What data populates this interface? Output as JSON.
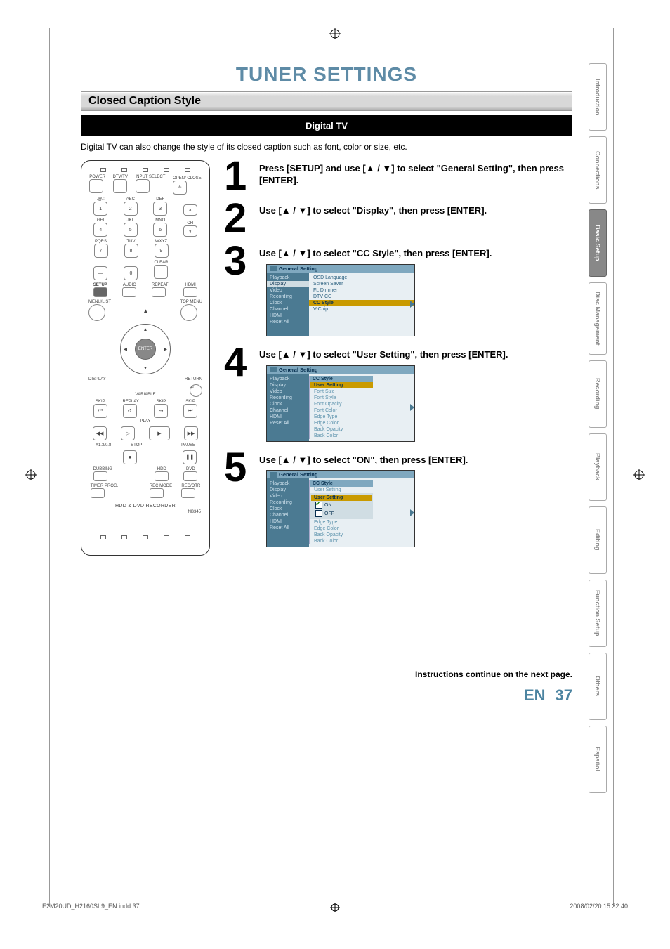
{
  "title": "TUNER SETTINGS",
  "section": "Closed Caption Style",
  "digital_tv": "Digital TV",
  "intro": "Digital TV can also change the style of its closed caption such as font, color or size, etc.",
  "remote": {
    "row1": [
      "POWER",
      "DTV/TV",
      "INPUT SELECT",
      "OPEN/ CLOSE"
    ],
    "numpad": [
      {
        "t": ".@/:",
        "n": "1"
      },
      {
        "t": "ABC",
        "n": "2"
      },
      {
        "t": "DEF",
        "n": "3"
      },
      {
        "t": "GHI",
        "n": "4"
      },
      {
        "t": "JKL",
        "n": "5"
      },
      {
        "t": "MNO",
        "n": "6"
      },
      {
        "t": "PQRS",
        "n": "7"
      },
      {
        "t": "TUV",
        "n": "8"
      },
      {
        "t": "WXYZ",
        "n": "9"
      }
    ],
    "clear": "CLEAR",
    "zero": "0",
    "ch": "CH",
    "row_setup": [
      "SETUP",
      "AUDIO",
      "REPEAT",
      "HDMI"
    ],
    "menu_list": "MENU/LIST",
    "top_menu": "TOP MENU",
    "enter": "ENTER",
    "display": "DISPLAY",
    "return": "RETURN",
    "variable": "VARIABLE",
    "skip": "SKIP",
    "replay": "REPLAY",
    "play": "PLAY",
    "speed": "X1.3/0.8",
    "stop": "STOP",
    "pause": "PAUSE",
    "dubbing": "DUBBING",
    "hdd": "HDD",
    "dvd": "DVD",
    "timer": "TIMER PROG.",
    "recmode": "REC MODE",
    "recotr": "REC/OTR",
    "logo": "HDD & DVD RECORDER",
    "model": "NB345"
  },
  "steps": {
    "s1": "Press [SETUP] and use [▲ / ▼] to select \"General Setting\", then press [ENTER].",
    "s2": "Use [▲ / ▼] to select \"Display\", then press [ENTER].",
    "s3": "Use [▲ / ▼] to select \"CC Style\", then press [ENTER].",
    "s4": "Use [▲ / ▼] to select \"User Setting\", then press [ENTER].",
    "s5": "Use [▲ / ▼] to select \"ON\", then press [ENTER]."
  },
  "osd": {
    "header": "General Setting",
    "left": [
      "Playback",
      "Display",
      "Video",
      "Recording",
      "Clock",
      "Channel",
      "HDMI",
      "Reset All"
    ],
    "box3_right": [
      "OSD Language",
      "Screen Saver",
      "FL Dimmer",
      "DTV CC",
      "CC Style",
      "V-Chip"
    ],
    "box4_panel_head": "CC Style",
    "box4_panel": [
      "User Setting",
      "Font Size",
      "Font Style",
      "Font Opacity",
      "Font Color",
      "Edge Type",
      "Edge Color",
      "Back Opacity",
      "Back Color"
    ],
    "box5_panel_head": "CC Style",
    "box5_panel_top": "User Setting",
    "box5_panel_sub_head": "User Setting",
    "box5_panel_sub": [
      "ON",
      "OFF"
    ],
    "box5_panel_tail": [
      "Edge Type",
      "Edge Color",
      "Back Opacity",
      "Back Color"
    ]
  },
  "continue": "Instructions continue on the next page.",
  "page_en": "EN",
  "page_no": "37",
  "tabs": [
    "Introduction",
    "Connections",
    "Basic Setup",
    "Disc Management",
    "Recording",
    "Playback",
    "Editing",
    "Function Setup",
    "Others",
    "Español"
  ],
  "footer_left": "E2M20UD_H2160SL9_EN.indd   37",
  "footer_right": "2008/02/20   15:32:40"
}
